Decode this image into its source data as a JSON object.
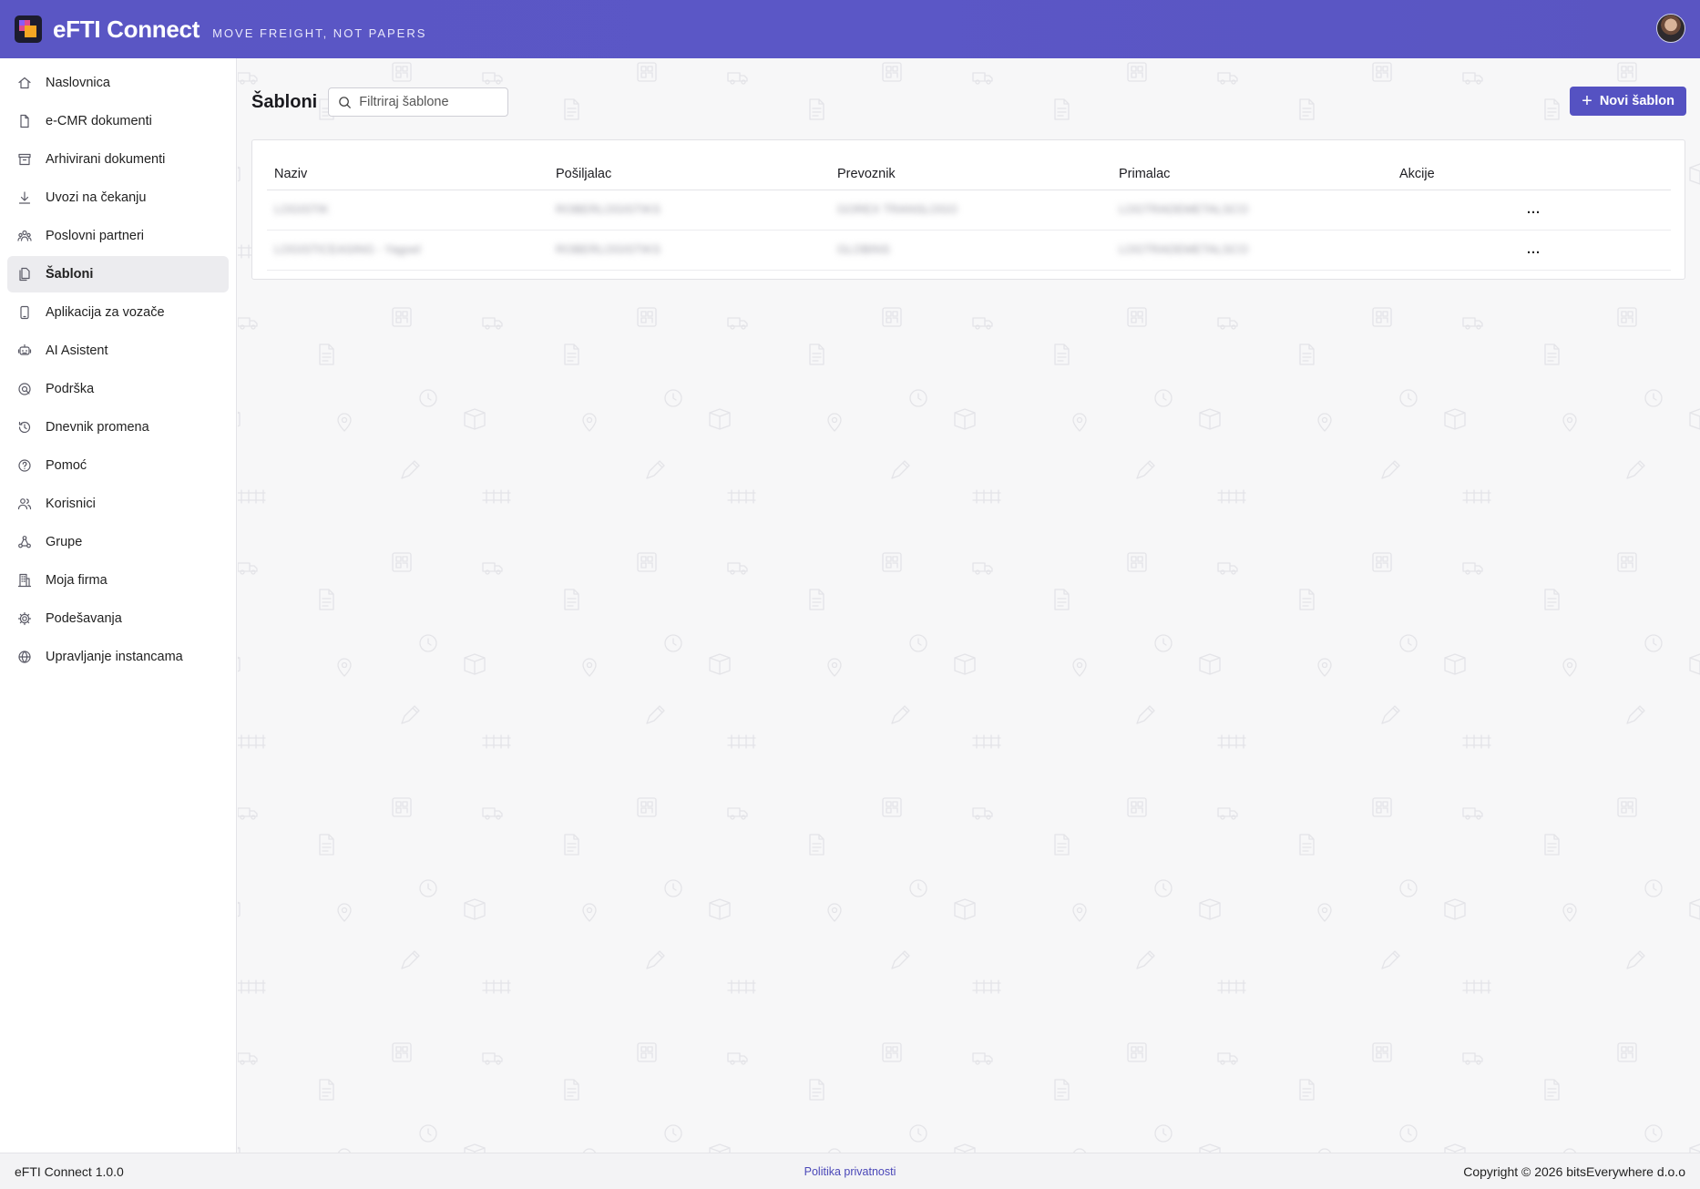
{
  "app": {
    "brand": "eFTI Connect",
    "tagline": "MOVE FREIGHT, NOT PAPERS"
  },
  "sidebar": {
    "items": [
      {
        "label": "Naslovnica",
        "icon": "home-icon"
      },
      {
        "label": "e-CMR dokumenti",
        "icon": "document-icon"
      },
      {
        "label": "Arhivirani dokumenti",
        "icon": "archive-icon"
      },
      {
        "label": "Uvozi na čekanju",
        "icon": "download-icon"
      },
      {
        "label": "Poslovni partneri",
        "icon": "partners-icon"
      },
      {
        "label": "Šabloni",
        "icon": "templates-icon",
        "active": true
      },
      {
        "label": "Aplikacija za vozače",
        "icon": "mobile-icon"
      },
      {
        "label": "AI Asistent",
        "icon": "robot-icon"
      },
      {
        "label": "Podrška",
        "icon": "support-icon"
      },
      {
        "label": "Dnevnik promena",
        "icon": "history-icon"
      },
      {
        "label": "Pomoć",
        "icon": "help-icon"
      },
      {
        "label": "Korisnici",
        "icon": "users-icon"
      },
      {
        "label": "Grupe",
        "icon": "groups-icon"
      },
      {
        "label": "Moja firma",
        "icon": "building-icon"
      },
      {
        "label": "Podešavanja",
        "icon": "gear-icon"
      },
      {
        "label": "Upravljanje instancama",
        "icon": "globe-icon"
      }
    ]
  },
  "main": {
    "title": "Šabloni",
    "search": {
      "placeholder": "Filtriraj šablone",
      "value": ""
    },
    "new_button": "Novi šablon",
    "table": {
      "columns": [
        "Naziv",
        "Pošiljalac",
        "Prevoznik",
        "Primalac",
        "Akcije"
      ],
      "rows": [
        {
          "naziv": "LOGISTIK",
          "posiljalac": "ROBERLOGISTIKS",
          "prevoznik": "GOREX TRANSLOGO",
          "primalac": "LOGTRADEMETALSCO",
          "akcije": "..."
        },
        {
          "naziv": "LOGISTICEASING - Yagoel",
          "posiljalac": "ROBERLOGISTIKS",
          "prevoznik": "GLOBINS",
          "primalac": "LOGTRADEMETALSCO",
          "akcije": "..."
        }
      ]
    }
  },
  "footer": {
    "version": "eFTI Connect 1.0.0",
    "privacy": "Politika privatnosti",
    "copyright": "Copyright © 2026 bitsEverywhere d.o.o"
  },
  "colors": {
    "header": "#5a56c4",
    "accent": "#5552c2",
    "link": "#4a47b8"
  }
}
